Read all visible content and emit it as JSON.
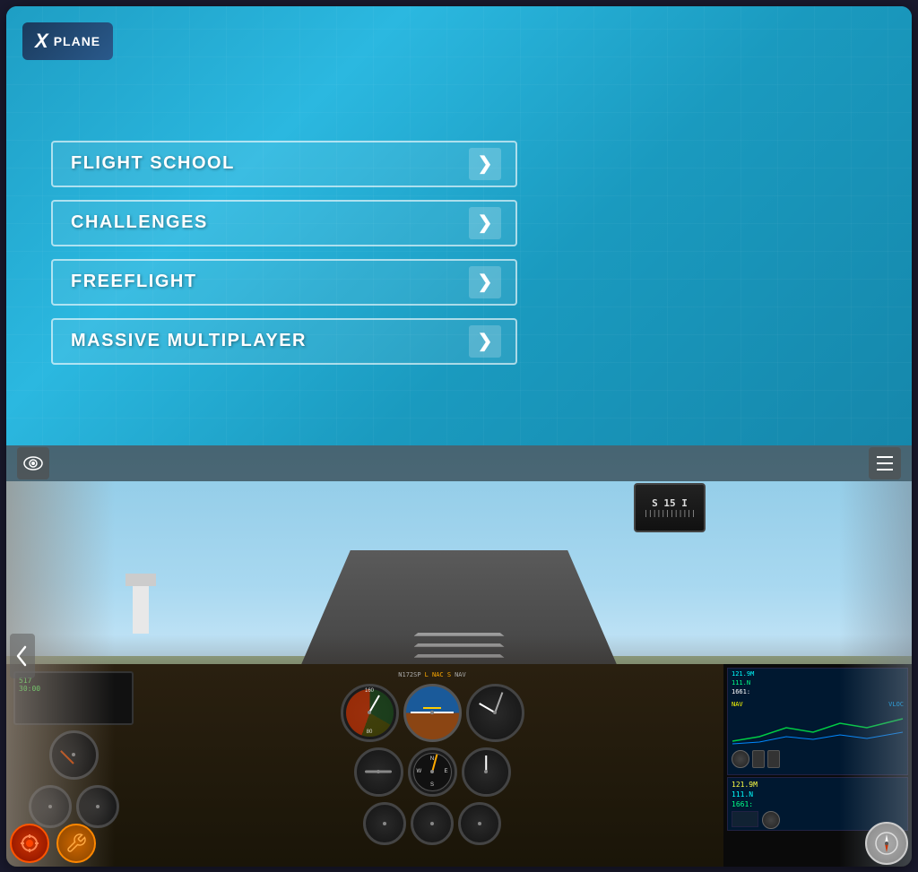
{
  "app": {
    "title": "X-Plane"
  },
  "logo": {
    "x_letter": "X",
    "plane_text": "PLANE"
  },
  "menu": {
    "items": [
      {
        "id": "flight-school",
        "label": "FLIGHT SCHOOL",
        "arrow": "❯"
      },
      {
        "id": "challenges",
        "label": "CHALLENGES",
        "arrow": "❯"
      },
      {
        "id": "freeflight",
        "label": "FREEFLIGHT",
        "arrow": "❯"
      },
      {
        "id": "massive-multiplayer",
        "label": "MASSIVE MULTIPLAYER",
        "arrow": "❯"
      }
    ]
  },
  "simulator": {
    "top_bar": {
      "eye_icon": "👁",
      "menu_icon": "≡"
    },
    "gps": {
      "line1": "121.9M",
      "line2": "111.N",
      "line3": "1661:",
      "nav_label": "NAV",
      "vloc_label": "VLOC"
    },
    "toolbar": {
      "engine_icon": "⚙",
      "wrench_icon": "🔧",
      "compass_icon": "🧭"
    }
  }
}
